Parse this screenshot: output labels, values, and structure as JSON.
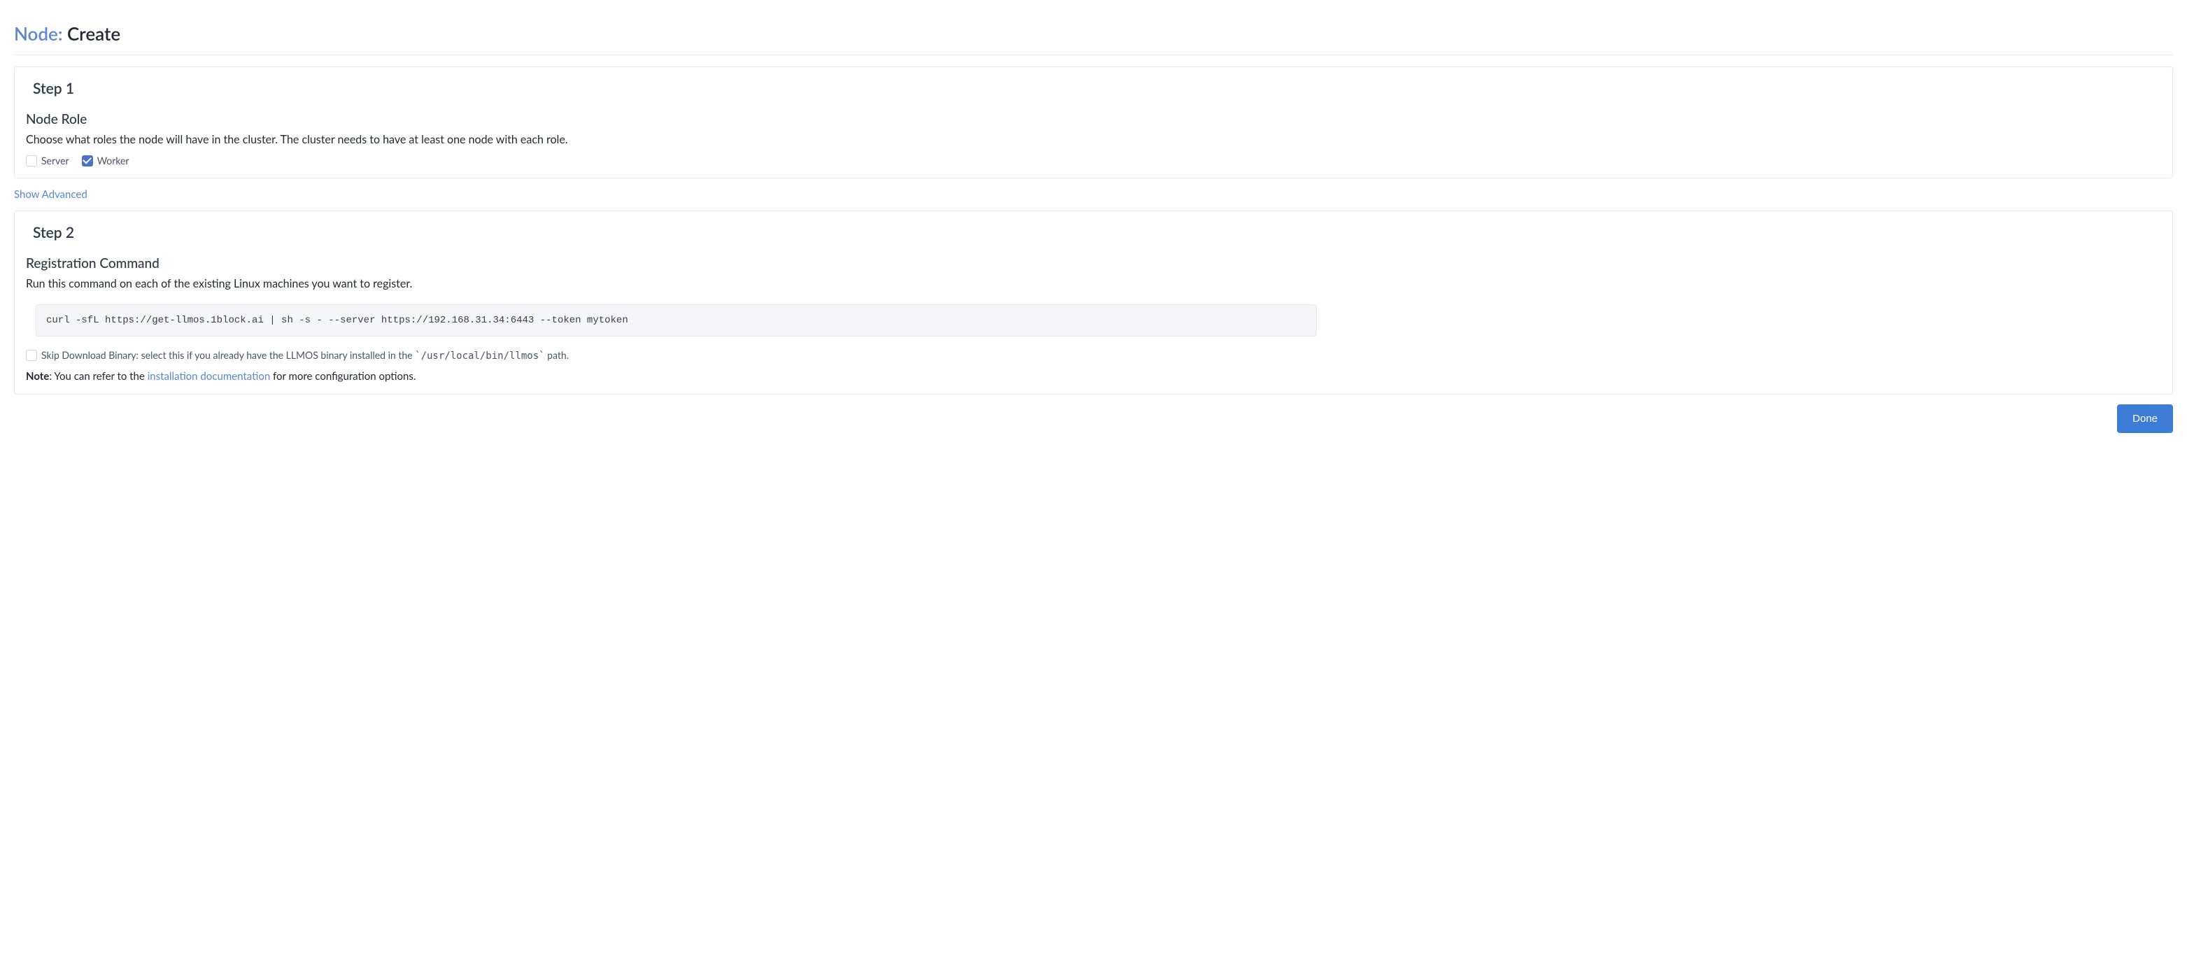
{
  "header": {
    "prefix": "Node: ",
    "title": "Create"
  },
  "step1": {
    "title": "Step 1",
    "section_title": "Node Role",
    "section_desc": "Choose what roles the node will have in the cluster. The cluster needs to have at least one node with each role.",
    "roles": {
      "server": {
        "label": "Server",
        "checked": false
      },
      "worker": {
        "label": "Worker",
        "checked": true
      }
    }
  },
  "show_advanced": "Show Advanced",
  "step2": {
    "title": "Step 2",
    "section_title": "Registration Command",
    "section_desc": "Run this command on each of the existing Linux machines you want to register.",
    "command": "curl -sfL https://get-llmos.1block.ai | sh -s - --server https://192.168.31.34:6443 --token mytoken",
    "skip_label_prefix": "Skip Download Binary: select this if you already have the LLMOS binary installed in the ",
    "skip_code": "`/usr/local/bin/llmos`",
    "skip_label_suffix": " path.",
    "skip_checked": false,
    "note_bold": "Note",
    "note_prefix": ": You can refer to the ",
    "note_link": "installation documentation",
    "note_suffix": " for more configuration options."
  },
  "actions": {
    "done": "Done"
  }
}
